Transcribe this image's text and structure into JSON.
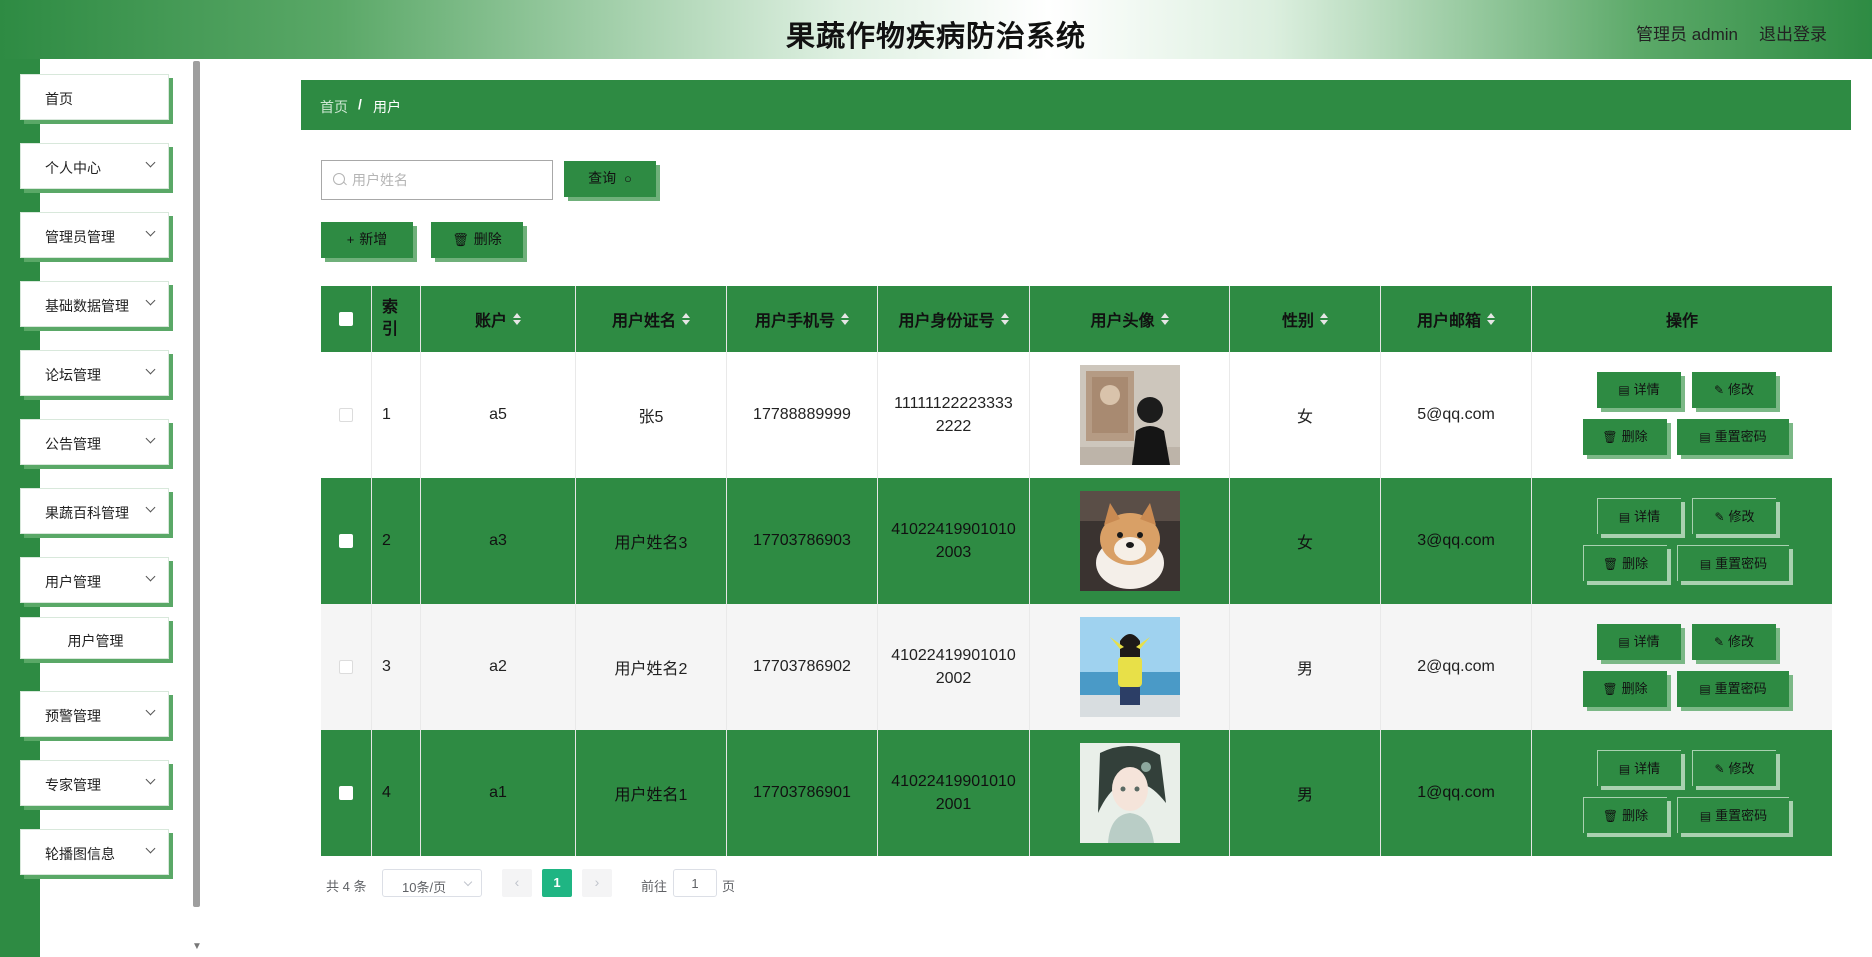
{
  "header": {
    "title": "果蔬作物疾病防治系统",
    "user": "管理员 admin",
    "logout": "退出登录"
  },
  "sidebar": {
    "items": [
      {
        "label": "首页"
      },
      {
        "label": "个人中心"
      },
      {
        "label": "管理员管理"
      },
      {
        "label": "基础数据管理"
      },
      {
        "label": "论坛管理"
      },
      {
        "label": "公告管理"
      },
      {
        "label": "果蔬百科管理"
      },
      {
        "label": "用户管理"
      },
      {
        "label": "预警管理"
      },
      {
        "label": "专家管理"
      },
      {
        "label": "轮播图信息"
      }
    ],
    "sub_item": "用户管理"
  },
  "breadcrumb": {
    "home": "首页",
    "separator": "/",
    "current": "用户"
  },
  "search": {
    "placeholder": "用户姓名",
    "value": "",
    "button": "查询"
  },
  "actions": {
    "add": "新增",
    "delete": "删除"
  },
  "table": {
    "headers": {
      "index": "索引",
      "account": "账户",
      "name": "用户姓名",
      "phone": "用户手机号",
      "idcard": "用户身份证号",
      "avatar": "用户头像",
      "gender": "性别",
      "email": "用户邮箱",
      "ops": "操作"
    },
    "op_labels": {
      "detail": "详情",
      "edit": "修改",
      "delete": "删除",
      "reset": "重置密码"
    },
    "rows": [
      {
        "index": "1",
        "account": "a5",
        "name": "张5",
        "phone": "17788889999",
        "idcard": "111111222233332222",
        "avatar": "avatar-person-back",
        "gender": "女",
        "email": "5@qq.com"
      },
      {
        "index": "2",
        "account": "a3",
        "name": "用户姓名3",
        "phone": "17703786903",
        "idcard": "410224199010102003",
        "avatar": "avatar-shiba-dog",
        "gender": "女",
        "email": "3@qq.com"
      },
      {
        "index": "3",
        "account": "a2",
        "name": "用户姓名2",
        "phone": "17703786902",
        "idcard": "410224199010102002",
        "avatar": "avatar-girl-yellow",
        "gender": "男",
        "email": "2@qq.com"
      },
      {
        "index": "4",
        "account": "a1",
        "name": "用户姓名1",
        "phone": "17703786901",
        "idcard": "410224199010102001",
        "avatar": "avatar-anime-girl",
        "gender": "男",
        "email": "1@qq.com"
      }
    ]
  },
  "pagination": {
    "total": "共 4 条",
    "page_size": "10条/页",
    "current_page": "1",
    "goto_label": "前往",
    "goto_value": "1",
    "unit": "页"
  },
  "colors": {
    "brand_green": "#2e8b43",
    "shadow_green": "#5aa867",
    "active_page": "#1fb583"
  }
}
